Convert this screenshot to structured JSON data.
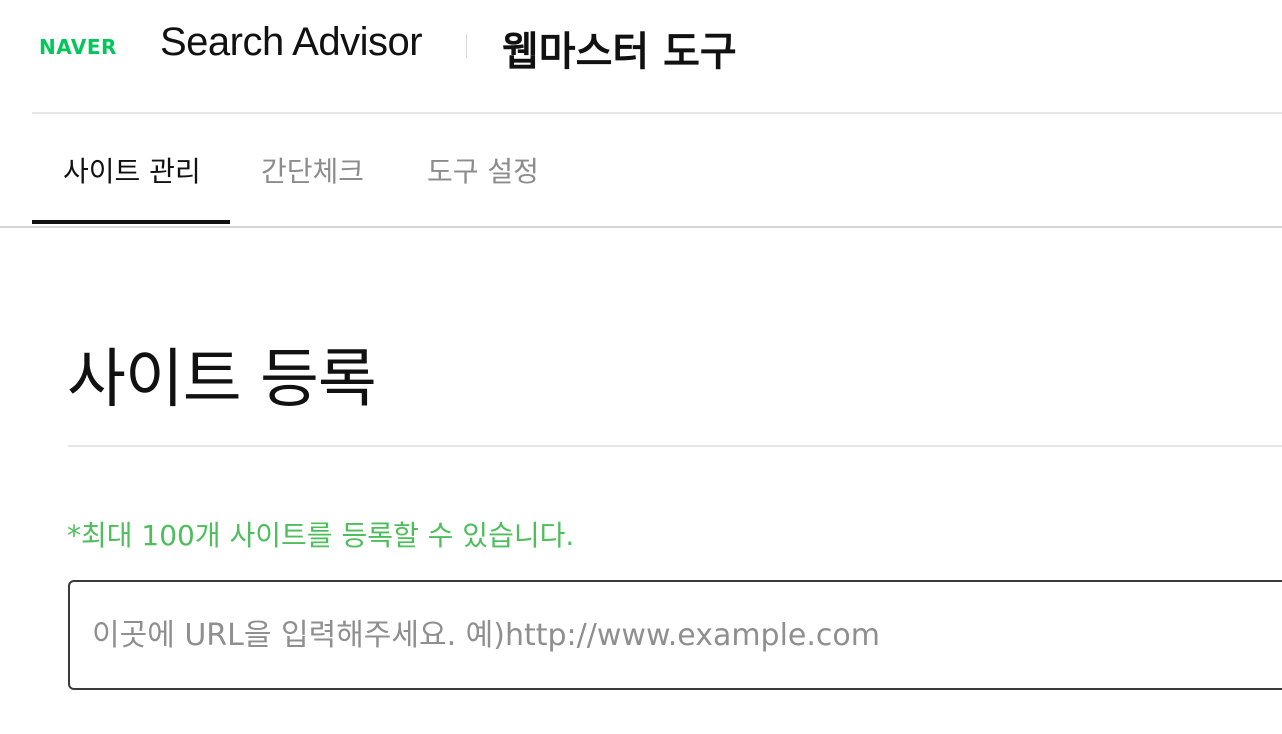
{
  "header": {
    "logo_text": "NAVER",
    "product_name": "Search Advisor",
    "tool_title": "웹마스터 도구",
    "logo_color": "#03c75a"
  },
  "nav": {
    "tabs": [
      {
        "label": "사이트 관리",
        "active": true
      },
      {
        "label": "간단체크",
        "active": false
      },
      {
        "label": "도구 설정",
        "active": false
      }
    ]
  },
  "main": {
    "title": "사이트 등록",
    "notice": "*최대 100개 사이트를 등록할 수 있습니다.",
    "notice_color": "#4cbf5b",
    "url_input": {
      "placeholder": "이곳에 URL을 입력해주세요. 예)http://www.example.com",
      "value": ""
    }
  }
}
